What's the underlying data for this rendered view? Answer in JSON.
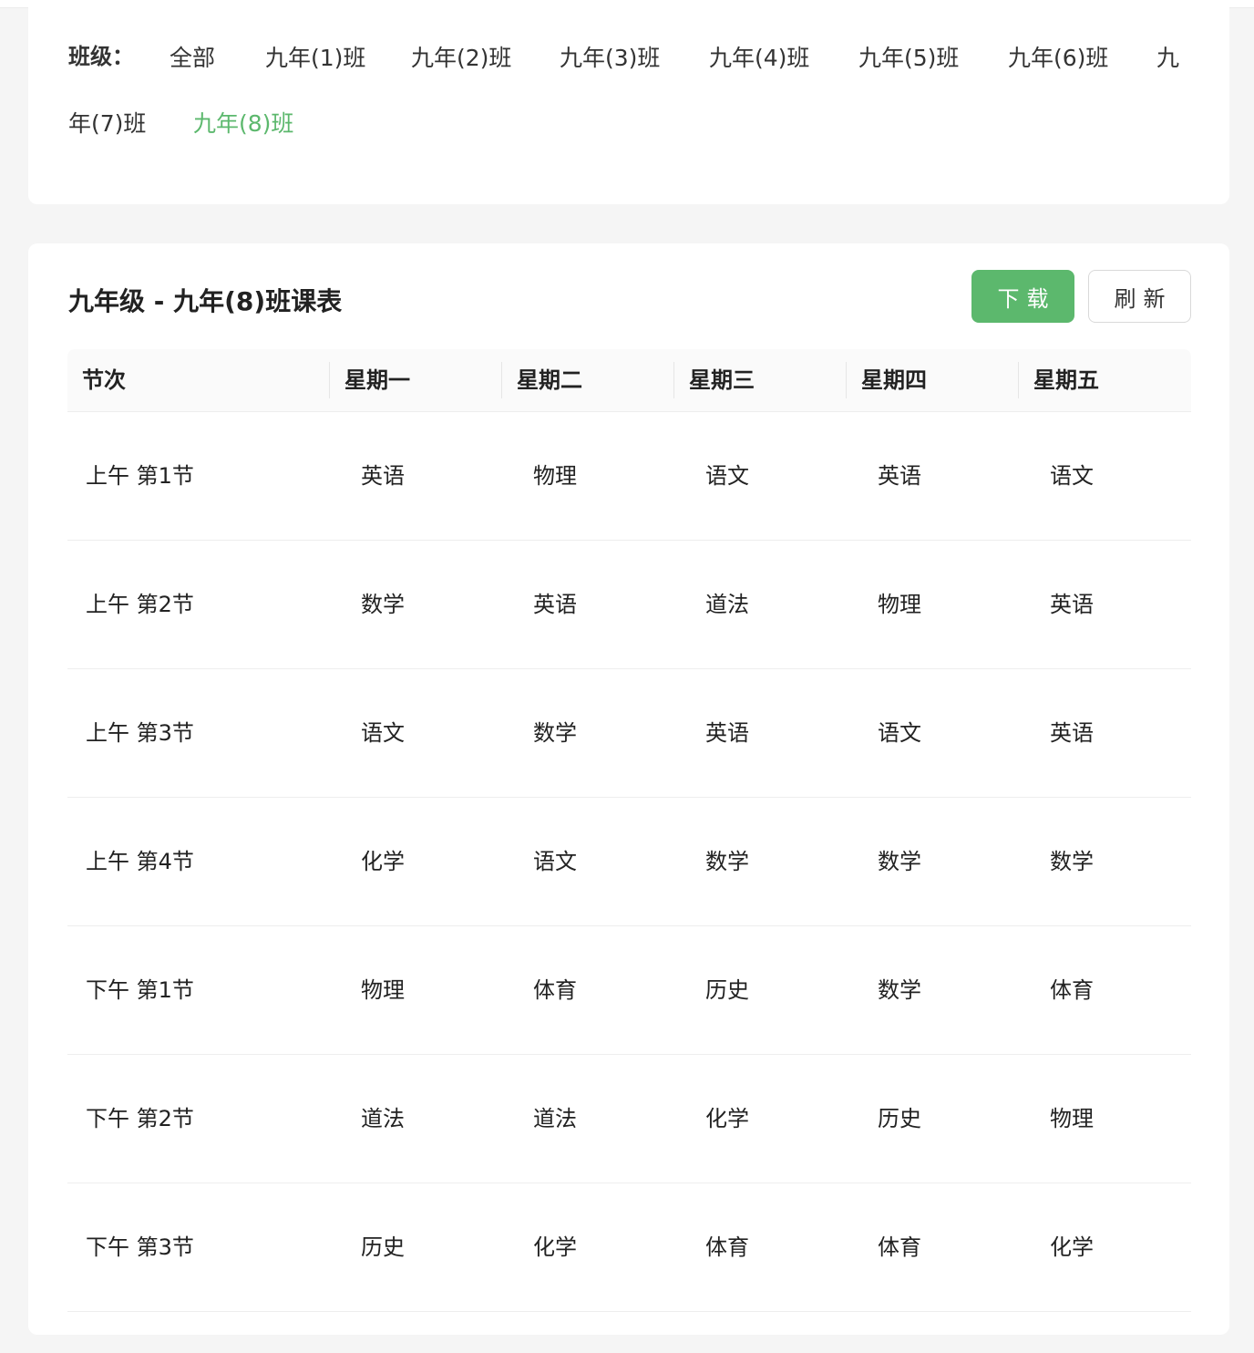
{
  "filter": {
    "label": "班级：",
    "options": [
      "全部",
      "九年(1)班",
      "九年(2)班",
      "九年(3)班",
      "九年(4)班",
      "九年(5)班",
      "九年(6)班",
      "九年(7)班",
      "九年(8)班"
    ],
    "selected": "九年(8)班",
    "accent_color": "#5cb86d"
  },
  "schedule": {
    "title": "九年级 - 九年(8)班课表",
    "download_label": "下载",
    "refresh_label": "刷新",
    "columns": [
      "节次",
      "星期一",
      "星期二",
      "星期三",
      "星期四",
      "星期五"
    ],
    "rows": [
      {
        "period": "上午 第1节",
        "classes": [
          "英语",
          "物理",
          "语文",
          "英语",
          "语文"
        ]
      },
      {
        "period": "上午 第2节",
        "classes": [
          "数学",
          "英语",
          "道法",
          "物理",
          "英语"
        ]
      },
      {
        "period": "上午 第3节",
        "classes": [
          "语文",
          "数学",
          "英语",
          "语文",
          "英语"
        ]
      },
      {
        "period": "上午 第4节",
        "classes": [
          "化学",
          "语文",
          "数学",
          "数学",
          "数学"
        ]
      },
      {
        "period": "下午 第1节",
        "classes": [
          "物理",
          "体育",
          "历史",
          "数学",
          "体育"
        ]
      },
      {
        "period": "下午 第2节",
        "classes": [
          "道法",
          "道法",
          "化学",
          "历史",
          "物理"
        ]
      },
      {
        "period": "下午 第3节",
        "classes": [
          "历史",
          "化学",
          "体育",
          "体育",
          "化学"
        ]
      }
    ]
  }
}
